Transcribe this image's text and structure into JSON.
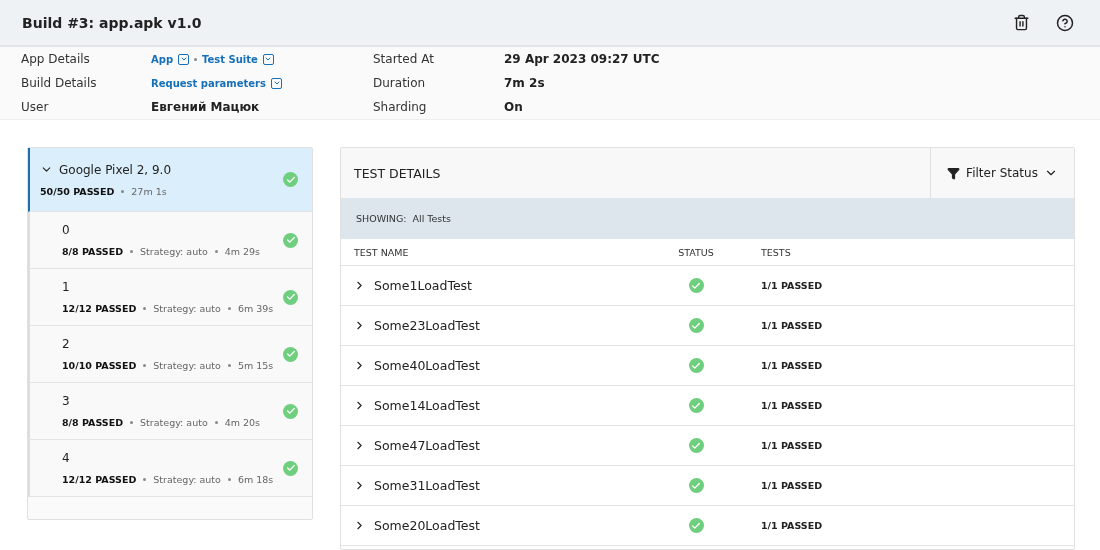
{
  "header": {
    "title": "Build #3: app.apk v1.0"
  },
  "details": [
    {
      "label": "App Details",
      "links": [
        "App",
        "Test Suite"
      ],
      "label2": "Started At",
      "value2": "29 Apr 2023 09:27 UTC"
    },
    {
      "label": "Build Details",
      "links": [
        "Request parameters"
      ],
      "label2": "Duration",
      "value2": "7m 2s"
    },
    {
      "label": "User",
      "value": "Евгений Мацюк",
      "label2": "Sharding",
      "value2": "On"
    }
  ],
  "devices": [
    {
      "name": "Google Pixel 2, 9.0",
      "passed": "50/50 PASSED",
      "duration": "27m 1s",
      "selected": true,
      "expanded": true,
      "children": [
        {
          "name": "0",
          "passed": "8/8 PASSED",
          "strategy": "Strategy: auto",
          "duration": "4m 29s",
          "selected": false
        },
        {
          "name": "1",
          "passed": "12/12 PASSED",
          "strategy": "Strategy: auto",
          "duration": "6m 39s",
          "selected": false
        },
        {
          "name": "2",
          "passed": "10/10 PASSED",
          "strategy": "Strategy: auto",
          "duration": "5m 15s",
          "selected": false
        },
        {
          "name": "3",
          "passed": "8/8 PASSED",
          "strategy": "Strategy: auto",
          "duration": "4m 20s",
          "selected": false
        },
        {
          "name": "4",
          "passed": "12/12 PASSED",
          "strategy": "Strategy: auto",
          "duration": "6m 18s",
          "selected": false
        }
      ]
    }
  ],
  "test_details": {
    "title": "TEST DETAILS",
    "filter": "Filter Status",
    "showing_label": "SHOWING:",
    "showing_value": "All Tests",
    "columns": [
      "TEST NAME",
      "STATUS",
      "TESTS"
    ],
    "rows": [
      {
        "name": "Some1LoadTest",
        "tests": "1/1 PASSED"
      },
      {
        "name": "Some23LoadTest",
        "tests": "1/1 PASSED"
      },
      {
        "name": "Some40LoadTest",
        "tests": "1/1 PASSED"
      },
      {
        "name": "Some14LoadTest",
        "tests": "1/1 PASSED"
      },
      {
        "name": "Some47LoadTest",
        "tests": "1/1 PASSED"
      },
      {
        "name": "Some31LoadTest",
        "tests": "1/1 PASSED"
      },
      {
        "name": "Some20LoadTest",
        "tests": "1/1 PASSED"
      }
    ]
  }
}
